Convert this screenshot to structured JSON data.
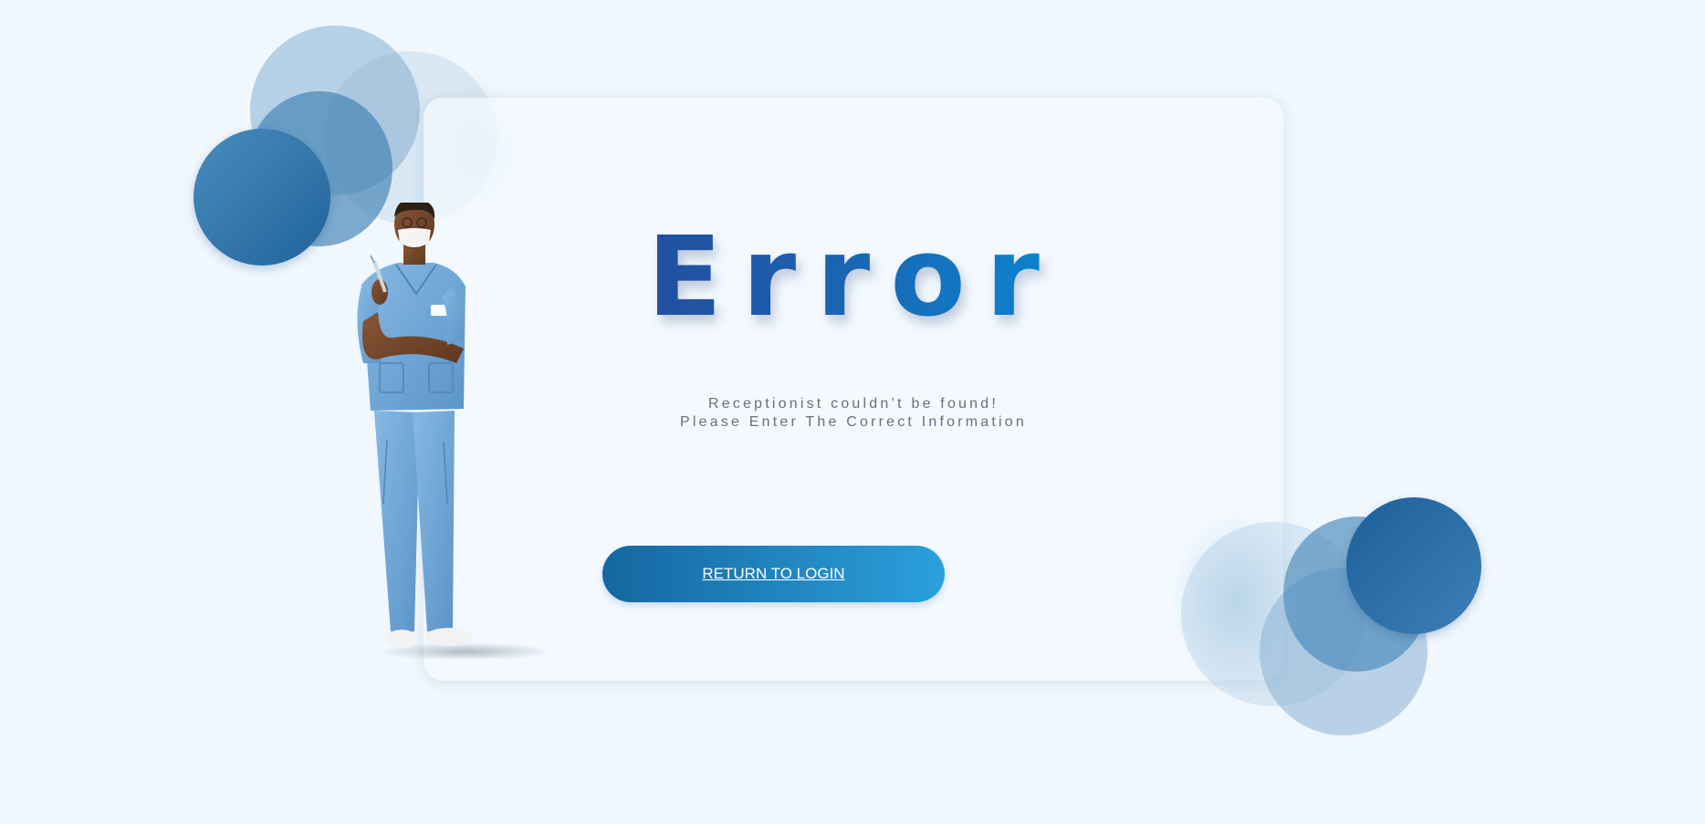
{
  "error": {
    "title": "Error",
    "message_line1": "Receptionist couldn’t be found!",
    "message_line2": "Please Enter The Correct Information",
    "button_label": "RETURN TO LOGIN"
  },
  "colors": {
    "background": "#f0f7fd",
    "title_gradient_start": "#2a3d92",
    "title_gradient_end": "#19b2ee",
    "button_gradient_start": "#1567a0",
    "button_gradient_end": "#2aa0dc",
    "message_text": "#6b6f78"
  },
  "illustration": {
    "icon": "nurse-illustration"
  }
}
